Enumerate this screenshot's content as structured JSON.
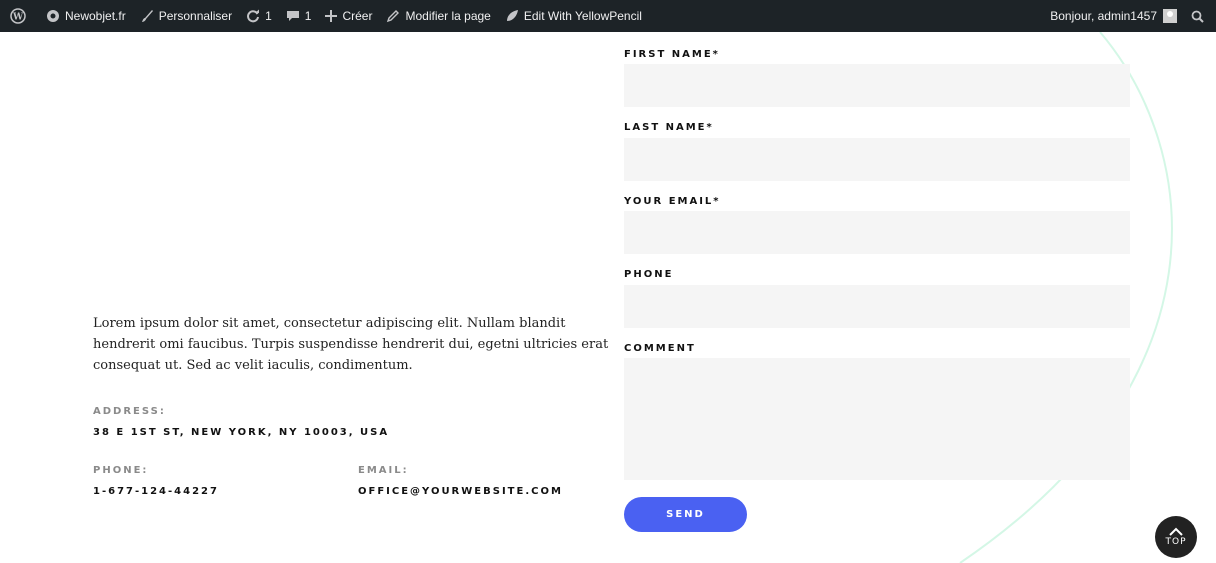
{
  "adminbar": {
    "site": "Newobjet.fr",
    "customize": "Personnaliser",
    "updates_count": "1",
    "comments_count": "1",
    "new": "Créer",
    "edit_page": "Modifier la page",
    "yellowpencil": "Edit With YellowPencil",
    "greeting": "Bonjour, admin1457"
  },
  "info": {
    "intro": "Lorem ipsum dolor sit amet, consectetur adipiscing elit. Nullam blandit hendrerit omi faucibus. Turpis suspendisse hendrerit  dui, egetni ultricies erat consequat ut. Sed ac velit iaculis, condimentum.",
    "address_label": "ADDRESS:",
    "address_value": "38 E 1ST ST, NEW YORK, NY 10003, USA",
    "phone_label": "PHONE:",
    "phone_value": "1-677-124-44227",
    "email_label": "EMAIL:",
    "email_value": "OFFICE@YOURWEBSITE.COM"
  },
  "form": {
    "first_name_label": "FIRST NAME*",
    "last_name_label": "LAST NAME*",
    "email_label": "YOUR EMAIL*",
    "phone_label": "PHONE",
    "comment_label": "COMMENT",
    "first_name_value": "",
    "last_name_value": "",
    "email_value": "",
    "phone_value": "",
    "comment_value": "",
    "send_label": "SEND"
  },
  "back_to_top": {
    "label": "TOP"
  },
  "colors": {
    "adminbar_bg": "#1d2327",
    "button_blue": "#4a61f2",
    "input_bg": "#f5f5f5",
    "deco_curve": "#d4f7e6"
  }
}
